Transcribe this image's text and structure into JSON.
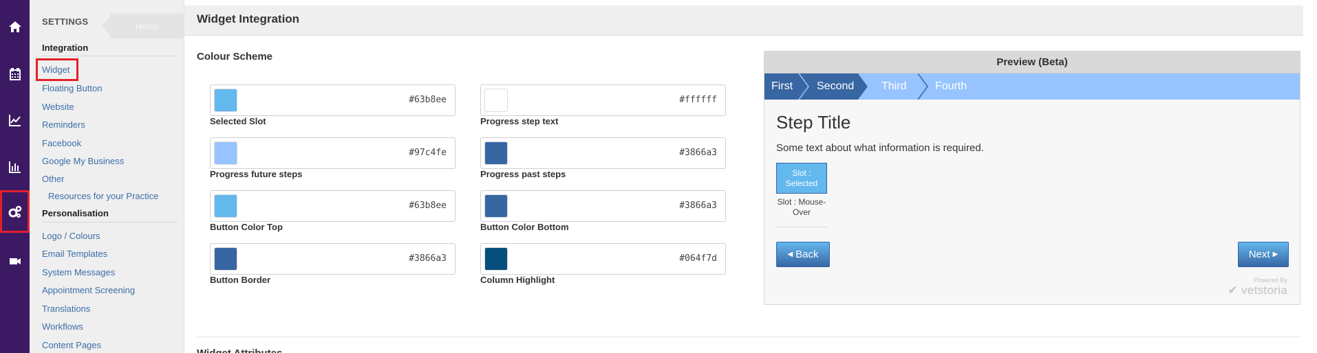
{
  "rail": {
    "items": [
      {
        "icon": "home-icon"
      },
      {
        "icon": "calendar-icon"
      },
      {
        "icon": "line-chart-icon"
      },
      {
        "icon": "bar-chart-icon"
      },
      {
        "icon": "gears-icon",
        "active": true
      },
      {
        "icon": "video-camera-icon"
      }
    ],
    "bg_color": "#3b1a63",
    "highlight_color": "#e3202a"
  },
  "sidebar": {
    "title": "SETTINGS",
    "ghost_label": "Home",
    "integration": {
      "label": "Integration",
      "items": [
        "Widget",
        "Floating Button",
        "Website",
        "Reminders",
        "Facebook",
        "Google My Business",
        "Other"
      ],
      "sub_items": [
        "Resources for your Practice"
      ]
    },
    "personalisation": {
      "label": "Personalisation",
      "items": [
        "Logo / Colours",
        "Email Templates",
        "System Messages",
        "Appointment Screening",
        "Translations",
        "Workflows",
        "Content Pages"
      ]
    }
  },
  "main": {
    "page_title": "Widget Integration",
    "colour_scheme": {
      "title": "Colour Scheme",
      "fields": [
        {
          "label": "Selected Slot",
          "value": "#63b8ee"
        },
        {
          "label": "Progress step text",
          "value": "#ffffff"
        },
        {
          "label": "Progress future steps",
          "value": "#97c4fe"
        },
        {
          "label": "Progress past steps",
          "value": "#3866a3"
        },
        {
          "label": "Button Color Top",
          "value": "#63b8ee"
        },
        {
          "label": "Button Color Bottom",
          "value": "#3866a3"
        },
        {
          "label": "Button Border",
          "value": "#3866a3"
        },
        {
          "label": "Column Highlight",
          "value": "#064f7d"
        }
      ]
    },
    "preview": {
      "title": "Preview (Beta)",
      "steps": [
        "First",
        "Second",
        "Third",
        "Fourth"
      ],
      "step_title": "Step Title",
      "step_text": "Some text about what information is required.",
      "slot_selected": "Slot : Selected",
      "slot_mouse_over": "Slot : Mouse-Over",
      "back_label": "Back",
      "next_label": "Next",
      "powered_by": "Powered By",
      "brand": "vetstoria"
    },
    "next_section": "Widget Attributes"
  }
}
